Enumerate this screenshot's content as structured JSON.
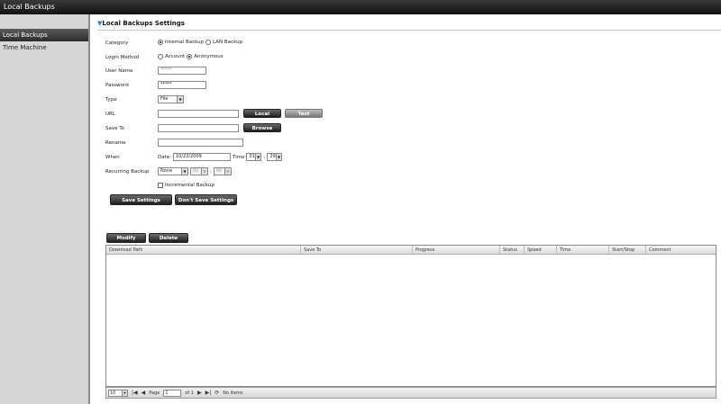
{
  "window": {
    "title": "Local Backups"
  },
  "sidebar": {
    "items": [
      {
        "label": "Local Backups"
      },
      {
        "label": "Time Machine"
      }
    ]
  },
  "section": {
    "title": "Local Backups Settings"
  },
  "form": {
    "category": {
      "label": "Category",
      "options": [
        "Internal Backup",
        "LAN Backup"
      ],
      "selected": "Internal Backup"
    },
    "login_method": {
      "label": "Login Method",
      "options": [
        "Account",
        "Anonymous"
      ],
      "selected": "Anonymous"
    },
    "user_name": {
      "label": "User Name",
      "value": "*****"
    },
    "password": {
      "label": "Password",
      "value": "*****"
    },
    "type": {
      "label": "Type",
      "value": "File"
    },
    "url": {
      "label": "URL",
      "value": "",
      "local_button": "Local",
      "test_button": "Test"
    },
    "save_to": {
      "label": "Save To",
      "value": "",
      "browse_button": "Browse"
    },
    "rename": {
      "label": "Rename",
      "value": ""
    },
    "when": {
      "label": "When",
      "date_label": "Date:",
      "date_value": "10/22/2009",
      "time_label": "Time",
      "hour": "01",
      "minute": "29"
    },
    "recurring": {
      "label": "Recurring Backup",
      "value": "None",
      "hour": "00",
      "minute": "00"
    },
    "incremental": {
      "label": "Incremental Backup",
      "checked": false
    },
    "save_button": "Save Settings",
    "dont_save_button": "Don't Save Settings"
  },
  "grid_actions": {
    "modify": "Modify",
    "delete": "Delete"
  },
  "grid": {
    "columns": [
      "Download Path",
      "Save To",
      "Progress",
      "Status",
      "Speed",
      "Time",
      "Start/Stop",
      "Comment"
    ],
    "rows": []
  },
  "pager": {
    "page_size": "10",
    "page_label": "Page",
    "page_value": "1",
    "of_label": "of 1",
    "status": "No items"
  },
  "colors": {
    "accent": "#1e88d8",
    "button_dark": "#2a2a2a",
    "sidebar_bg": "#d6d6d6"
  }
}
